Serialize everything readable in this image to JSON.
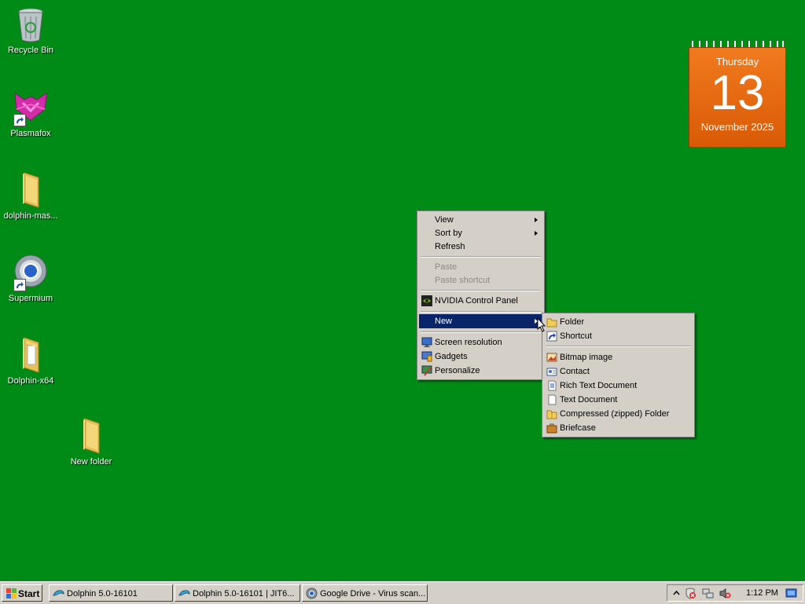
{
  "desktop": {
    "background_color": "#008a16",
    "icons": [
      {
        "label": "Recycle Bin",
        "icon": "recycle-bin-icon"
      },
      {
        "label": "Plasmafox",
        "icon": "plasmafox-icon"
      },
      {
        "label": "dolphin-mas...",
        "icon": "folder-icon"
      },
      {
        "label": "Supermium",
        "icon": "supermium-icon"
      },
      {
        "label": "Dolphin-x64",
        "icon": "folder-icon"
      },
      {
        "label": "New folder",
        "icon": "folder-icon"
      }
    ]
  },
  "calendar": {
    "day_of_week": "Thursday",
    "day": "13",
    "month_year": "November 2025",
    "color": "#e8670f"
  },
  "context_menu": {
    "items": [
      {
        "label": "View",
        "submenu": true
      },
      {
        "label": "Sort by",
        "submenu": true
      },
      {
        "label": "Refresh"
      },
      {
        "label": "Paste",
        "disabled": true
      },
      {
        "label": "Paste shortcut",
        "disabled": true
      },
      {
        "label": "NVIDIA Control Panel",
        "icon": "nvidia-icon"
      },
      {
        "label": "New",
        "submenu": true,
        "highlighted": true
      },
      {
        "label": "Screen resolution",
        "icon": "display-icon"
      },
      {
        "label": "Gadgets",
        "icon": "gadgets-icon"
      },
      {
        "label": "Personalize",
        "icon": "personalize-icon"
      }
    ],
    "highlight_color": "#0a246a"
  },
  "new_submenu": {
    "items": [
      {
        "label": "Folder",
        "icon": "folder-icon"
      },
      {
        "label": "Shortcut",
        "icon": "shortcut-icon"
      },
      {
        "label": "Bitmap image",
        "icon": "bitmap-icon"
      },
      {
        "label": "Contact",
        "icon": "contact-icon"
      },
      {
        "label": "Rich Text Document",
        "icon": "rtf-icon"
      },
      {
        "label": "Text Document",
        "icon": "text-document-icon"
      },
      {
        "label": "Compressed (zipped) Folder",
        "icon": "zip-folder-icon"
      },
      {
        "label": "Briefcase",
        "icon": "briefcase-icon"
      }
    ]
  },
  "taskbar": {
    "start_label": "Start",
    "buttons": [
      {
        "label": "Dolphin 5.0-16101",
        "icon": "dolphin-icon"
      },
      {
        "label": "Dolphin 5.0-16101 | JIT6...",
        "icon": "dolphin-icon"
      },
      {
        "label": "Google Drive - Virus scan...",
        "icon": "chromium-icon"
      }
    ],
    "tray": {
      "icons": [
        "show-hidden-icons-icon",
        "security-alert-icon",
        "network-icon",
        "volume-muted-icon"
      ],
      "clock": "1:12 PM"
    }
  }
}
